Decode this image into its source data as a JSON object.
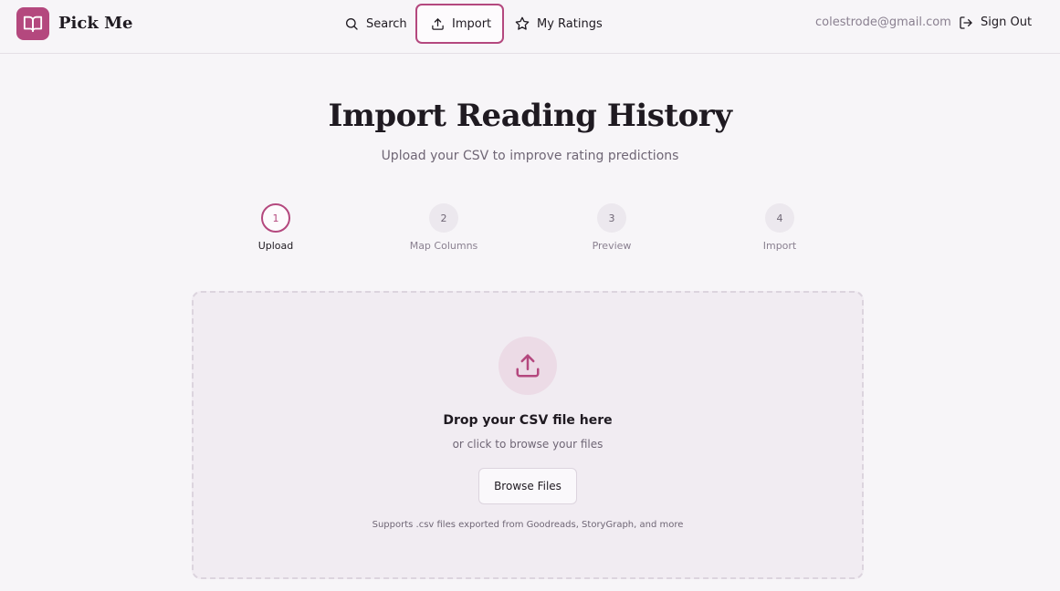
{
  "app": {
    "name": "Pick Me",
    "logo_icon": "open-book-icon"
  },
  "nav": {
    "search_label": "Search",
    "import_label": "Import",
    "ratings_label": "My Ratings",
    "active": "Import"
  },
  "user": {
    "email": "colestrode@gmail.com",
    "signout_label": "Sign Out"
  },
  "page": {
    "title": "Import Reading History",
    "subtitle": "Upload your CSV to improve rating predictions"
  },
  "steps": [
    {
      "number": "1",
      "label": "Upload",
      "state": "active"
    },
    {
      "number": "2",
      "label": "Map Columns",
      "state": "inactive"
    },
    {
      "number": "3",
      "label": "Preview",
      "state": "inactive"
    },
    {
      "number": "4",
      "label": "Import",
      "state": "inactive"
    }
  ],
  "dropzone": {
    "icon": "upload-icon",
    "title": "Drop your CSV file here",
    "subtitle": "or click to browse your files",
    "button_label": "Browse Files",
    "supports_text": "Supports .csv files exported from Goodreads, StoryGraph, and more"
  },
  "colors": {
    "accent": "#b4487e",
    "background": "#f7f5f8",
    "dropzone_bg": "#f1ecf2",
    "muted_text": "#6f6675"
  }
}
